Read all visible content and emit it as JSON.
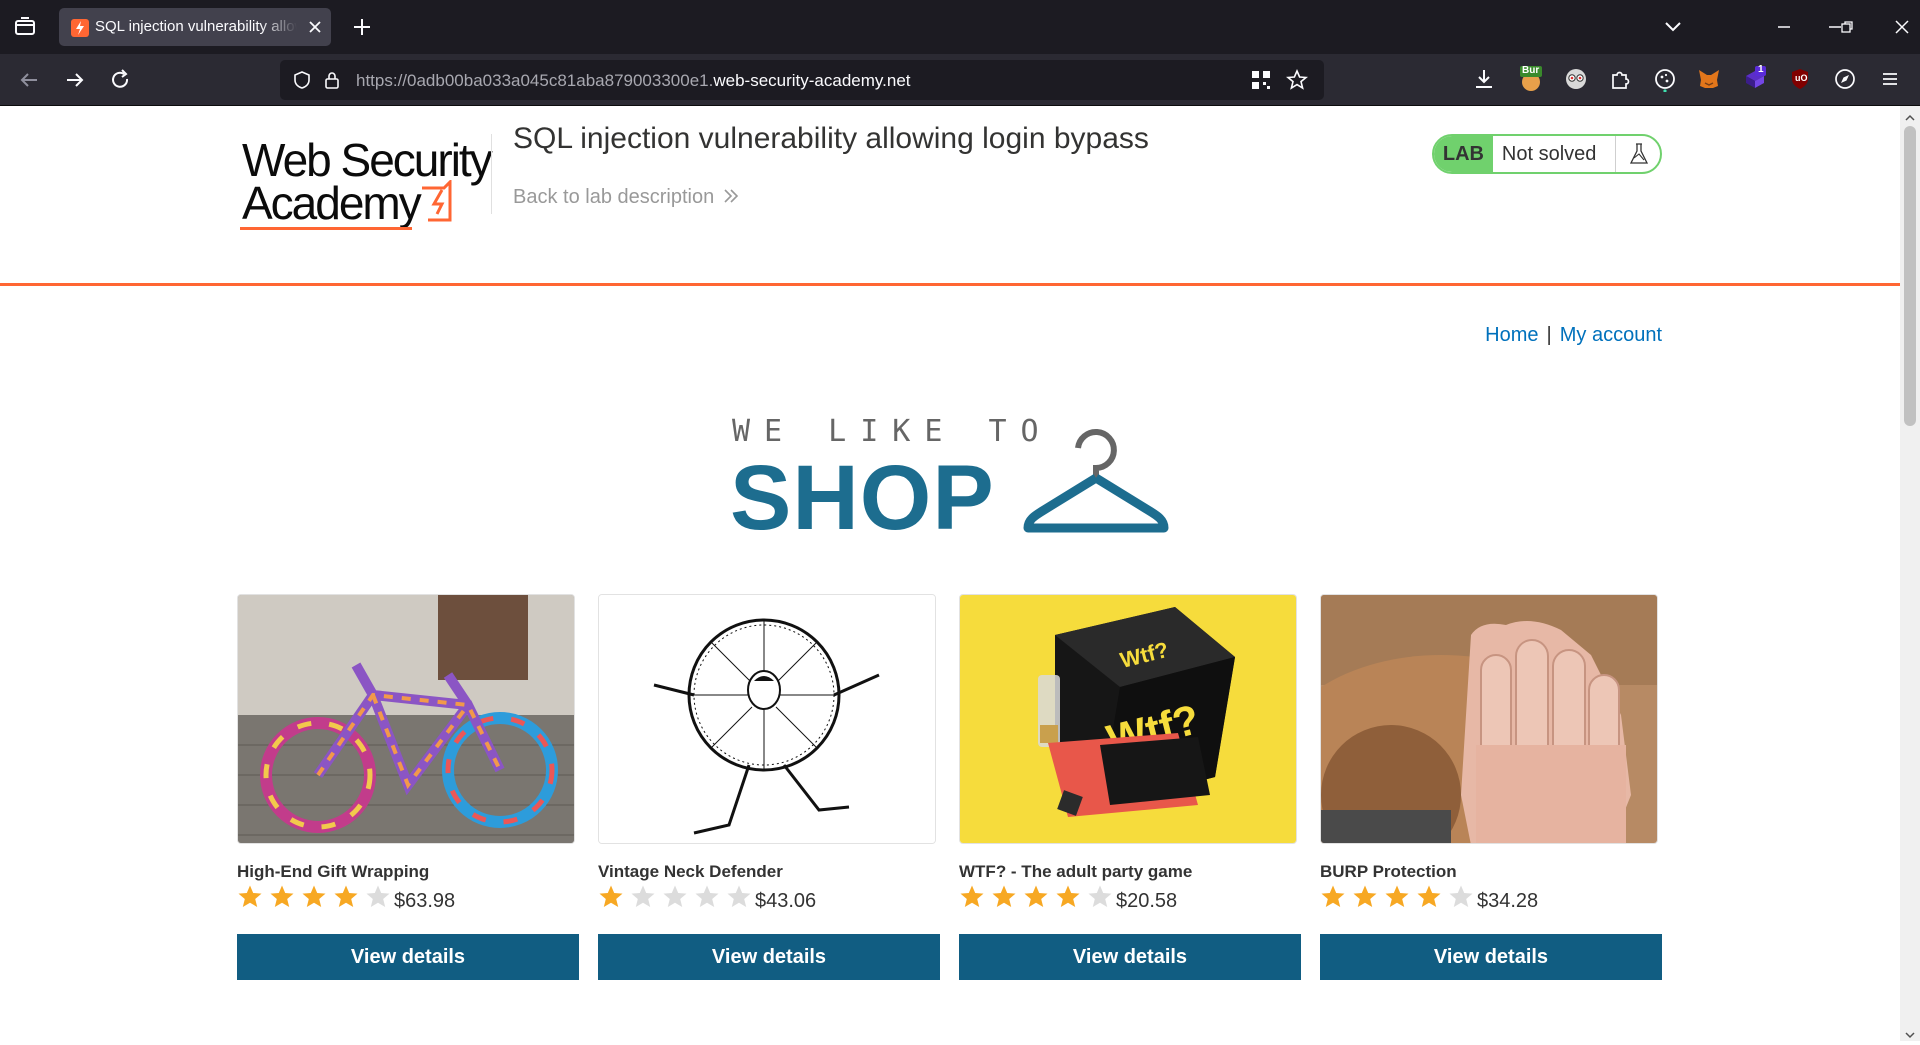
{
  "browser": {
    "tab_title": "SQL injection vulnerability allowing login bypass",
    "url_prefix": "https://0adb00ba033a045c81aba879003300e1.",
    "url_domain": "web-security-academy.net",
    "ext_badge_burp": "Bur",
    "ext_badge_count": "1",
    "ext_badge_ublock": "uO"
  },
  "header": {
    "logo_line1": "Web Security",
    "logo_line2": "Academy",
    "lab_title": "SQL injection vulnerability allowing login bypass",
    "back_link": "Back to lab description",
    "lab_badge": "LAB",
    "lab_status": "Not solved"
  },
  "nav": {
    "home": "Home",
    "separator": "|",
    "my_account": "My account"
  },
  "banner": {
    "small": "WE LIKE TO",
    "big": "SHOP"
  },
  "products": [
    {
      "name": "High-End Gift Wrapping",
      "rating": 4,
      "price": "$63.98",
      "button": "View details"
    },
    {
      "name": "Vintage Neck Defender",
      "rating": 1,
      "price": "$43.06",
      "button": "View details"
    },
    {
      "name": "WTF? - The adult party game",
      "rating": 4,
      "price": "$20.58",
      "button": "View details"
    },
    {
      "name": "BURP Protection",
      "rating": 4,
      "price": "$34.28",
      "button": "View details"
    }
  ],
  "colors": {
    "accent_orange": "#ff6633",
    "button_blue": "#115d82",
    "link_blue": "#0071bc",
    "lab_green": "#70d16d",
    "star_gold": "#f7a823",
    "star_empty": "#dcdcdc"
  }
}
